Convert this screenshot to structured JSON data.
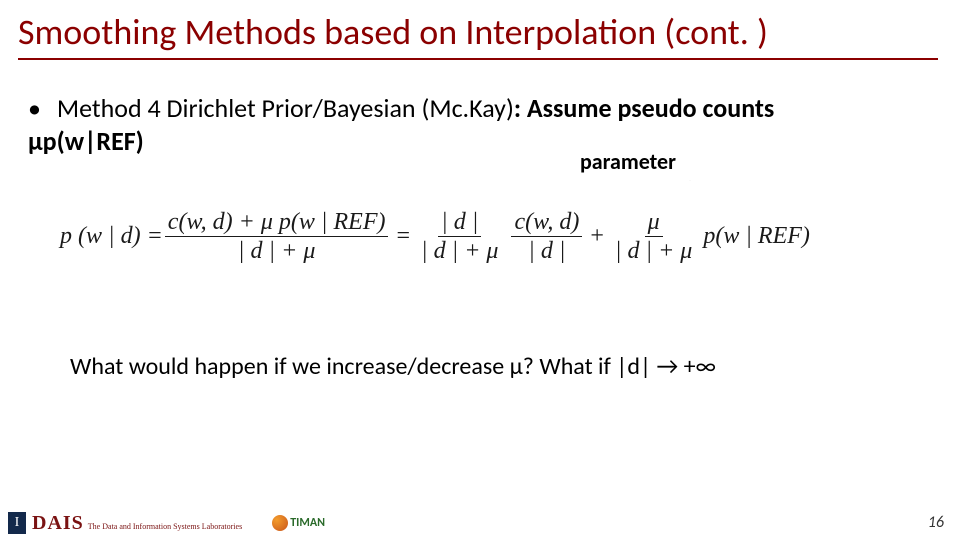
{
  "title": "Smoothing Methods based on Interpolation (cont. )",
  "bullet": {
    "lead": "Method 4 Dirichlet Prior/Bayesian (Mc.Kay)",
    "colon": ": ",
    "bold_tail": "Assume pseudo counts",
    "line2_bold": "μp(w|REF)"
  },
  "param_label": "parameter",
  "equation": {
    "lhs": "p (w | d) =",
    "frac1_num_a": "c(w, d) + μ p(w | REF)",
    "frac1_den": "| d | + μ",
    "eq2": "=",
    "frac2_num": "| d |",
    "frac2_den": "| d | + μ",
    "frac3_num": "c(w, d)",
    "frac3_den": "| d |",
    "plus": "+",
    "frac4_num": "μ",
    "frac4_den": "| d | + μ",
    "tail": "p(w | REF)"
  },
  "question": "What would happen if we increase/decrease μ? What if |d| → +∞",
  "footer": {
    "illinois_I": "I",
    "dais": "DAIS",
    "dais_sub": "The Data and Information Systems Laboratories",
    "timan": "TIMAN"
  },
  "page_number": "16"
}
